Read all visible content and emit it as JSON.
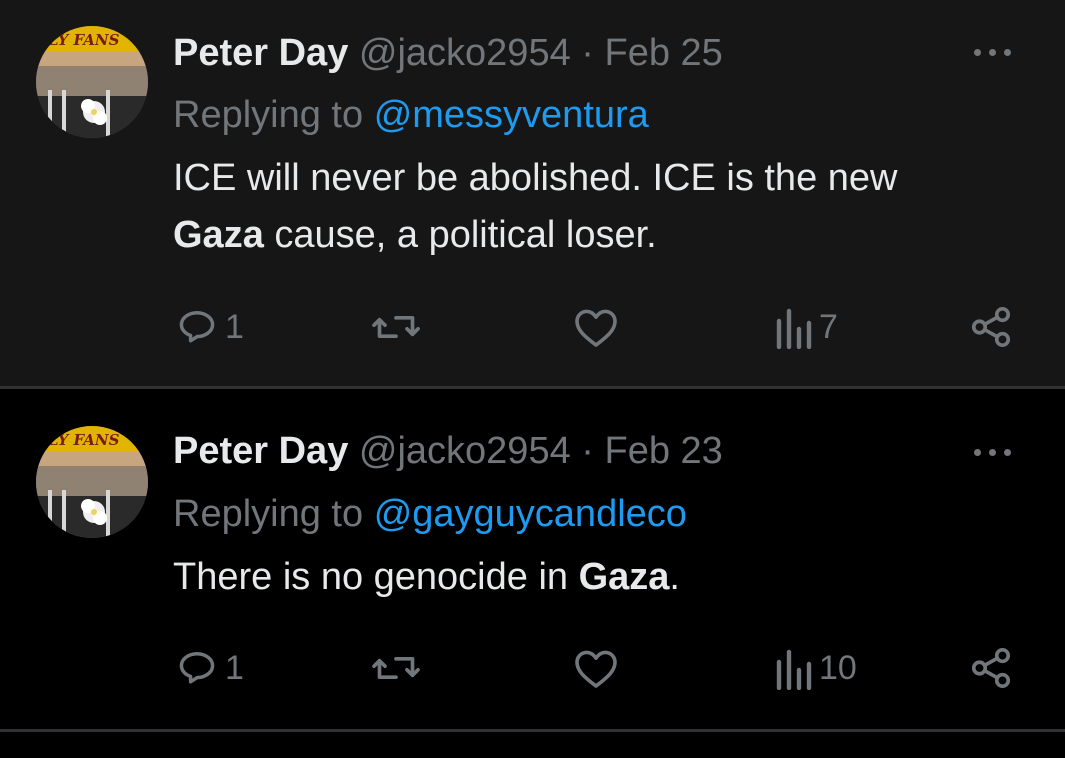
{
  "tweets": [
    {
      "author_name": "Peter Day",
      "handle_date": "@jacko2954 · Feb 25",
      "replying_prefix": "Replying to",
      "replying_handle": "@messyventura",
      "text_line1": "ICE will never be abolished.  ICE is the new",
      "text_bold": "Gaza",
      "text_line2_rest": " cause, a political loser.",
      "reply_count": "1",
      "views": "7"
    },
    {
      "author_name": "Peter Day",
      "handle_date": "@jacko2954 · Feb 23",
      "replying_prefix": "Replying to",
      "replying_handle": "@gayguycandleco",
      "text_pre": "There is no genocide in ",
      "text_bold": "Gaza",
      "text_post": ".",
      "reply_count": "1",
      "views": "10"
    }
  ],
  "avatar_sign_text": "LY FANS",
  "colors": {
    "background": "#000000",
    "tweet1_background": "#161616",
    "primary_text": "#e7e9ea",
    "secondary_text": "#71767b",
    "link": "#1d9bf0",
    "divider": "#2f3336"
  },
  "icons": [
    "more-icon",
    "reply-icon",
    "retweet-icon",
    "like-icon",
    "views-icon",
    "share-icon"
  ]
}
